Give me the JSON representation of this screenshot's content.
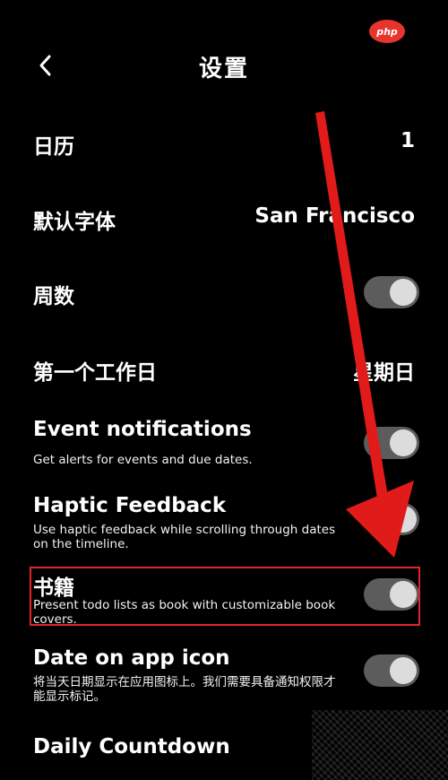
{
  "header": {
    "title": "设置",
    "back_icon": "chevron-left-icon"
  },
  "watermark": "php",
  "settings": {
    "calendar": {
      "label": "日历",
      "value": "1"
    },
    "default_font": {
      "label": "默认字体",
      "value": "San Francisco"
    },
    "week_number": {
      "label": "周数",
      "toggle": "on"
    },
    "first_workday": {
      "label": "第一个工作日",
      "value": "星期日"
    },
    "event_notifications": {
      "label": "Event notifications",
      "description": "Get alerts for events and due dates.",
      "toggle": "on"
    },
    "haptic_feedback": {
      "label": "Haptic Feedback",
      "description": "Use haptic feedback while scrolling through dates on the timeline.",
      "toggle": "on"
    },
    "books": {
      "label": "书籍",
      "description": "Present todo lists as book with customizable book covers.",
      "toggle": "on"
    },
    "date_on_app_icon": {
      "label": "Date on app icon",
      "description": "将当天日期显示在应用图标上。我们需要具备通知权限才能显示标记。",
      "toggle": "on"
    },
    "daily_countdown": {
      "label": "Daily Countdown"
    }
  },
  "colors": {
    "background": "#000000",
    "text": "#ffffff",
    "toggle_track": "#5c5c5c",
    "toggle_knob": "#dcdcdc",
    "annotation": "#e02626"
  }
}
